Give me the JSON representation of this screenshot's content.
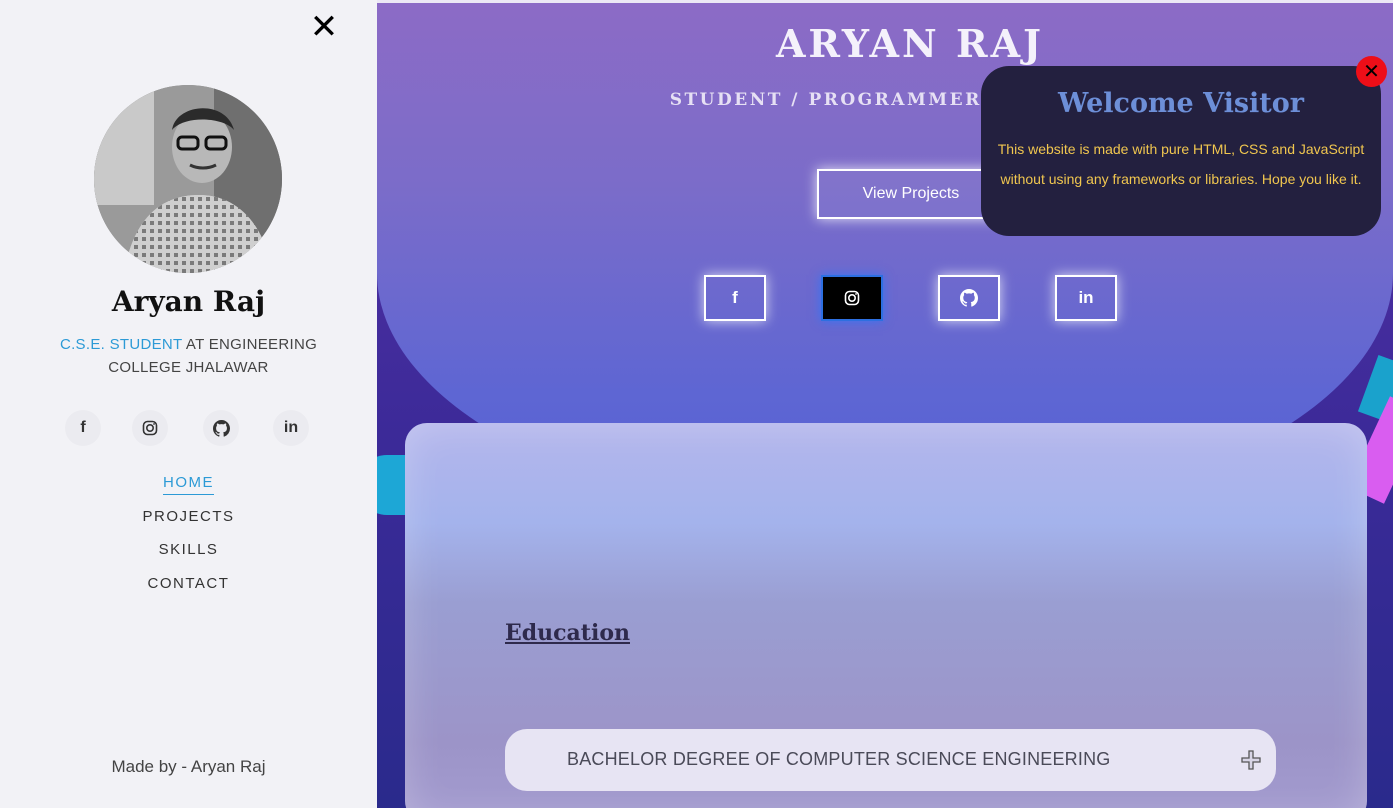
{
  "sidebar": {
    "close_symbol": "✕",
    "name": "Aryan Raj",
    "tagline_accent": "C.S.E. STUDENT",
    "tagline_rest": " AT ENGINEERING COLLEGE JHALAWAR",
    "social": [
      {
        "icon": "facebook-icon",
        "glyph": "f"
      },
      {
        "icon": "instagram-icon",
        "glyph": ""
      },
      {
        "icon": "github-icon",
        "glyph": ""
      },
      {
        "icon": "linkedin-icon",
        "glyph": "in"
      }
    ],
    "nav": [
      {
        "label": "HOME",
        "active": true
      },
      {
        "label": "PROJECTS",
        "active": false
      },
      {
        "label": "SKILLS",
        "active": false
      },
      {
        "label": "CONTACT",
        "active": false
      }
    ],
    "footer": "Made by - Aryan Raj"
  },
  "hero": {
    "name": "ARYAN RAJ",
    "role": "STUDENT / PROGRAMMER / DEVELOPER",
    "cta_label": "View Projects",
    "social": [
      {
        "icon": "facebook-icon",
        "glyph": "f"
      },
      {
        "icon": "instagram-icon",
        "glyph": ""
      },
      {
        "icon": "github-icon",
        "glyph": ""
      },
      {
        "icon": "linkedin-icon",
        "glyph": "in"
      }
    ]
  },
  "education": {
    "title": "Education",
    "degree": "BACHELOR DEGREE OF COMPUTER SCIENCE ENGINEERING"
  },
  "popup": {
    "title": "Welcome Visitor",
    "body": "This website is made with pure HTML, CSS and JavaScript without using any frameworks or libraries. Hope you like it.",
    "close_symbol": "✕"
  },
  "colors": {
    "accent": "#2c9ad6",
    "popup_title": "#6d8fd8",
    "popup_text": "#f0c64f",
    "close_red": "#ee0e18"
  }
}
